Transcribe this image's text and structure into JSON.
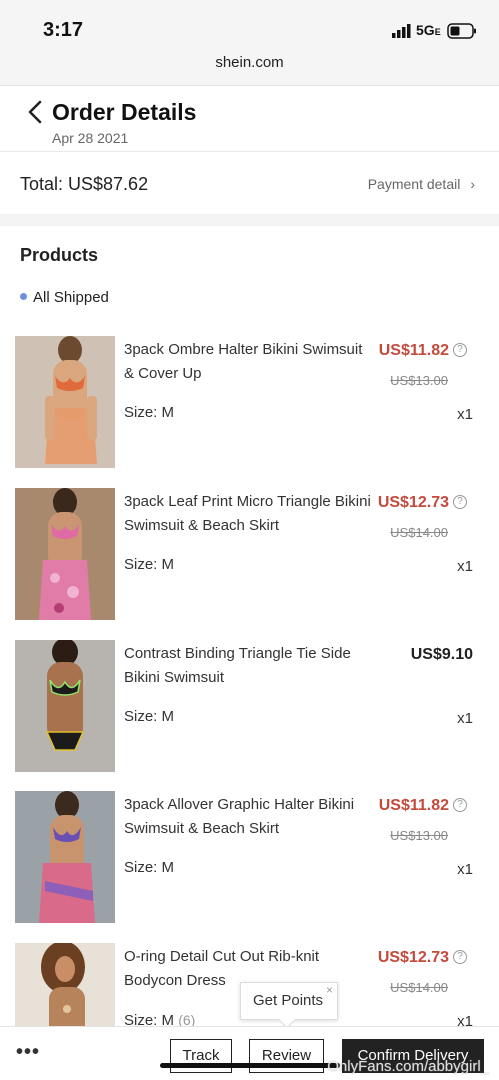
{
  "status": {
    "time": "3:17",
    "network": "5G",
    "network_suffix": "E"
  },
  "browser": {
    "url": "shein.com"
  },
  "header": {
    "title": "Order Details",
    "date": "Apr 28 2021"
  },
  "summary": {
    "total": "Total: US$87.62",
    "payment_detail": "Payment detail",
    "chevron": "›"
  },
  "products": {
    "title": "Products",
    "status": "All Shipped",
    "items": [
      {
        "name": "3pack Ombre Halter Bikini Swimsuit & Cover Up",
        "price": "US$11.82",
        "original": "US$13.00",
        "size": "Size: M",
        "qty": "x1",
        "info": "?"
      },
      {
        "name": "3pack Leaf Print Micro Triangle Bikini Swimsuit & Beach Skirt",
        "price": "US$12.73",
        "original": "US$14.00",
        "size": "Size: M",
        "qty": "x1",
        "info": "?"
      },
      {
        "name": "Contrast Binding Triangle Tie Side Bikini Swimsuit",
        "price": "US$9.10",
        "size": "Size: M",
        "qty": "x1"
      },
      {
        "name": "3pack Allover Graphic Halter Bikini Swimsuit & Beach Skirt",
        "price": "US$11.82",
        "original": "US$13.00",
        "size": "Size: M",
        "qty": "x1",
        "info": "?"
      },
      {
        "name": "O-ring Detail Cut Out Rib-knit Bodycon Dress",
        "price": "US$12.73",
        "original": "US$14.00",
        "size": "Size: M",
        "size_count": "(6)",
        "qty": "x1",
        "info": "?"
      }
    ]
  },
  "tooltip": {
    "text": "Get Points",
    "close": "×"
  },
  "actions": {
    "more": "•••",
    "track": "Track",
    "review": "Review",
    "confirm": "Confirm Delivery"
  },
  "watermark": "OnlyFans.com/abbygirl_",
  "colors": {
    "sale_price": "#c44a3c",
    "status_dot": "#6e8fe0",
    "confirm_bg": "#222222"
  }
}
